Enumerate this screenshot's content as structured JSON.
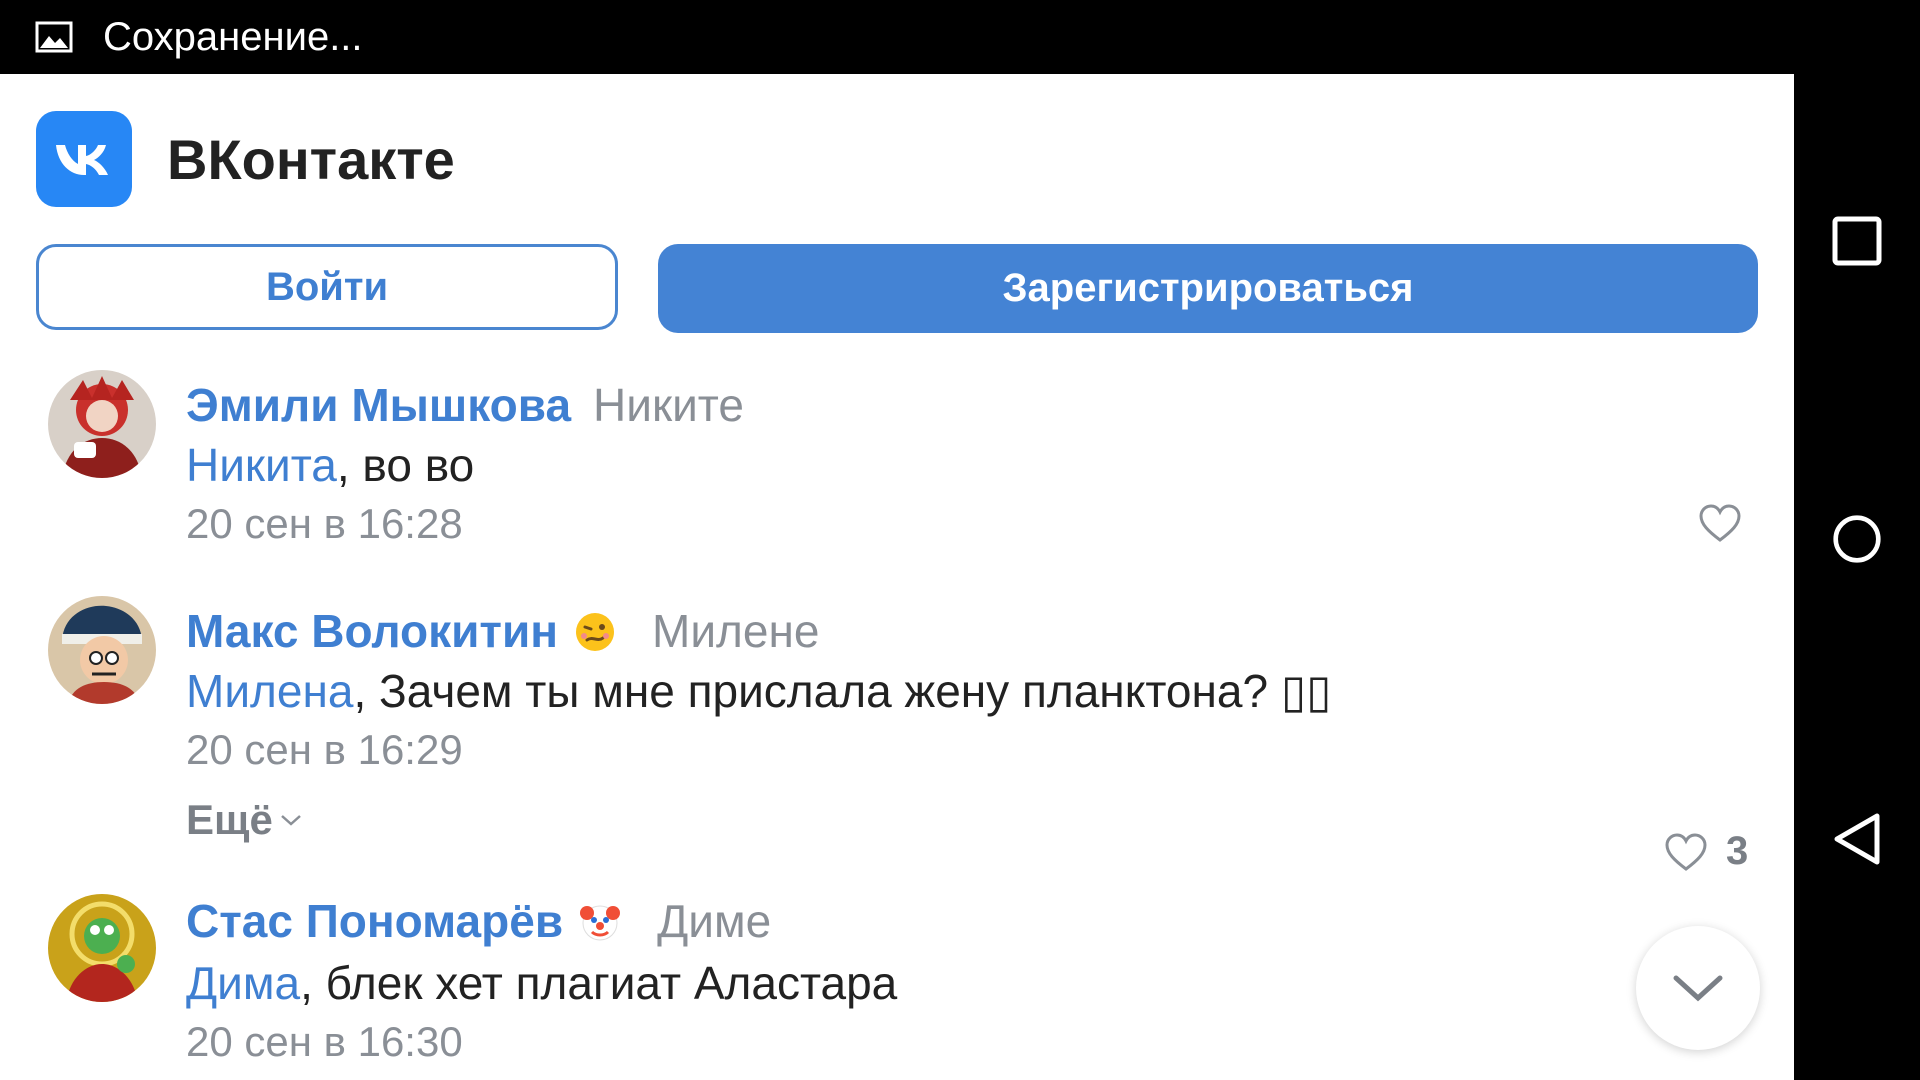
{
  "status_bar": {
    "text": "Сохранение...",
    "icon": "image-icon"
  },
  "app": {
    "title": "ВКонтакте",
    "logo": "vk-logo",
    "brand_color": "#2787F5",
    "login_label": "Войти",
    "register_label": "Зарегистрироваться"
  },
  "comments": [
    {
      "author": "Эмили Мышкова",
      "reply_to": "Никите",
      "mention": "Никита",
      "text": ", во во",
      "date": "20 сен в 16:28",
      "likes": ""
    },
    {
      "author": "Макс Волокитин",
      "emoji": "woozy-face-emoji",
      "reply_to": "Милене",
      "mention": "Милена",
      "text": ", Зачем ты мне прислала жену планктона? ",
      "text_tail_glyphs": "▯▯",
      "date": "20 сен в 16:29",
      "more_label": "Ещё",
      "likes": "3"
    },
    {
      "author": "Стас Пономарёв",
      "emoji": "clown-face-emoji",
      "reply_to": "Диме",
      "mention": "Дима",
      "text": ", блек хет плагиат Аластара",
      "date": "20 сен в 16:30",
      "likes": ""
    }
  ],
  "nav": {
    "recents": "square-icon",
    "home": "circle-icon",
    "back": "triangle-back-icon"
  }
}
